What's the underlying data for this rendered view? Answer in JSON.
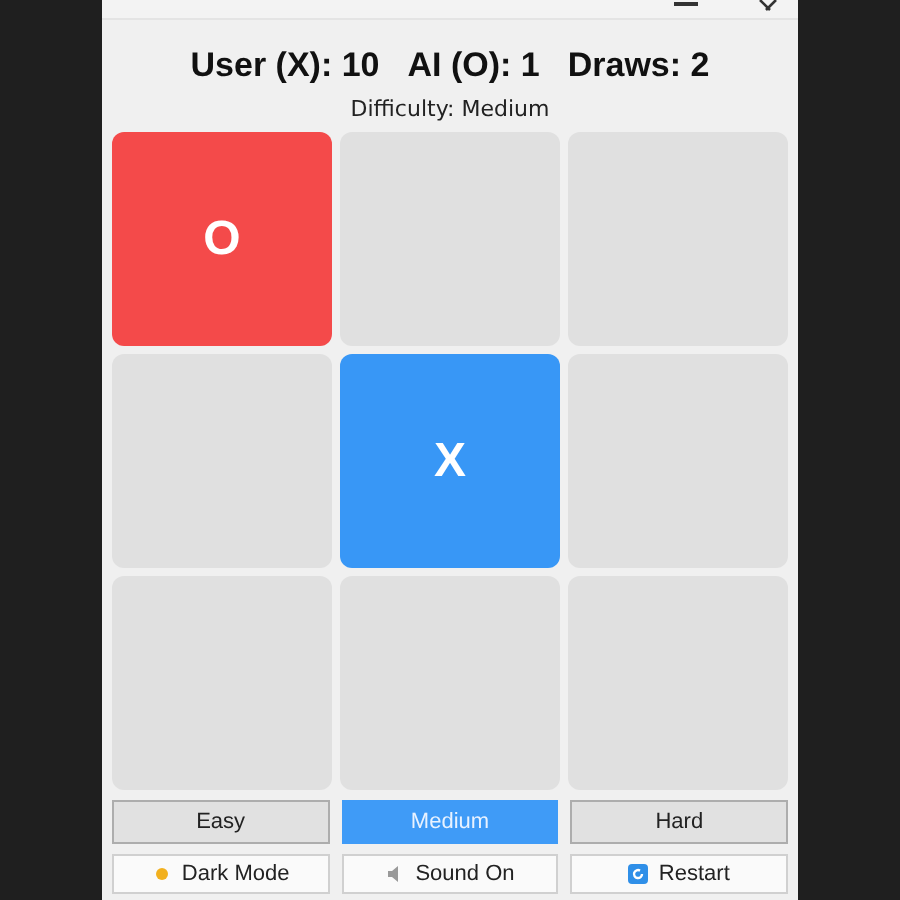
{
  "score": {
    "user": "User (X): 10",
    "ai": "AI (O): 1",
    "draws": "Draws: 2"
  },
  "difficulty_label": "Difficulty: Medium",
  "board": [
    {
      "kind": "o",
      "mark": "O"
    },
    {
      "kind": "empty"
    },
    {
      "kind": "empty"
    },
    {
      "kind": "empty"
    },
    {
      "kind": "x",
      "mark": "X"
    },
    {
      "kind": "empty"
    },
    {
      "kind": "empty"
    },
    {
      "kind": "empty"
    },
    {
      "kind": "empty"
    }
  ],
  "difficulty_buttons": [
    {
      "label": "Easy",
      "selected": false
    },
    {
      "label": "Medium",
      "selected": true
    },
    {
      "label": "Hard",
      "selected": false
    }
  ],
  "option_buttons": [
    {
      "kind": "theme",
      "label": "Dark Mode"
    },
    {
      "kind": "sound",
      "label": "Sound On"
    },
    {
      "kind": "restart",
      "label": "Restart"
    }
  ]
}
